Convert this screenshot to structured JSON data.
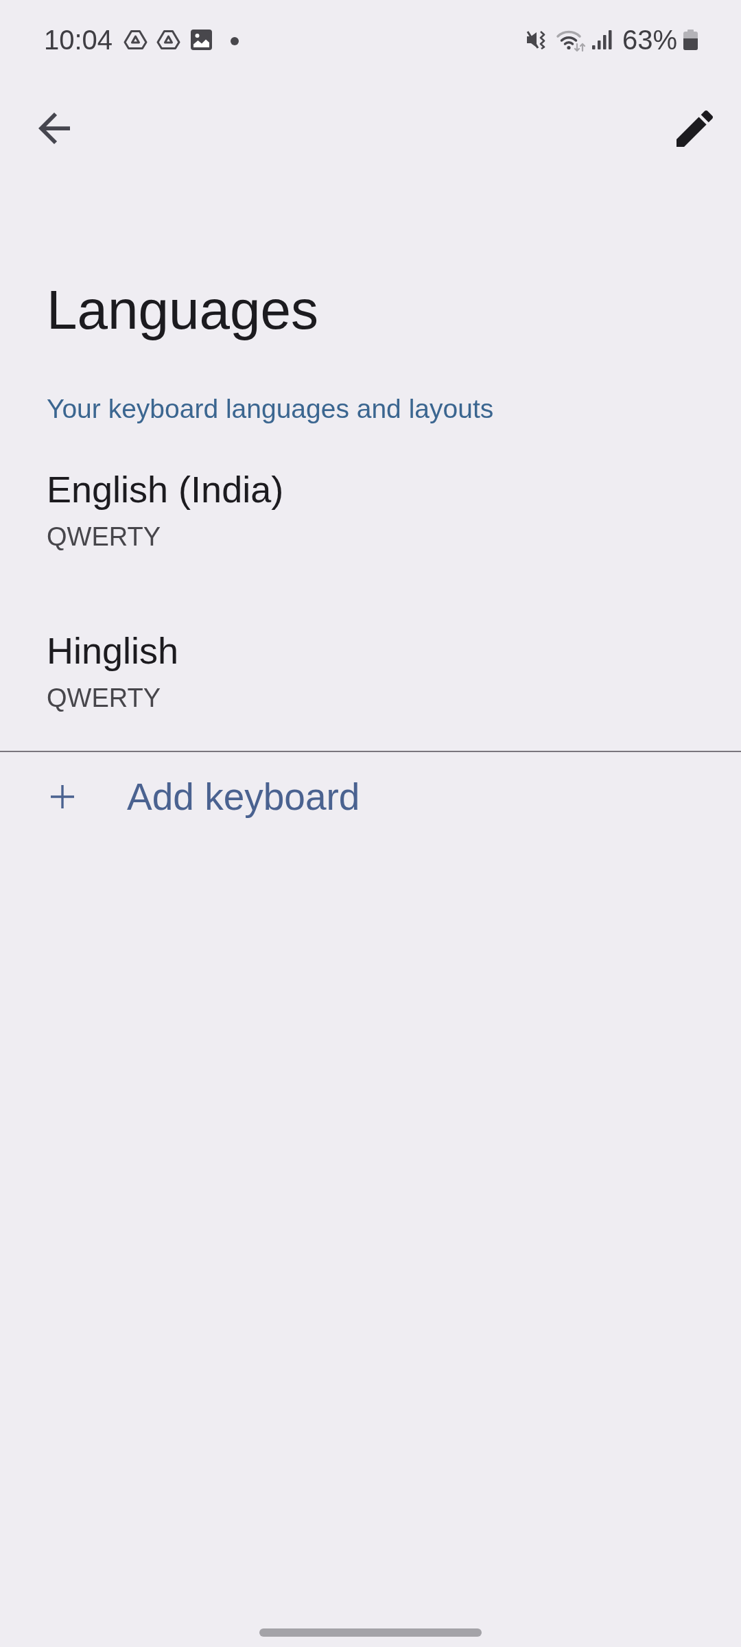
{
  "status_bar": {
    "time": "10:04",
    "battery_percent": "63%"
  },
  "title": "Languages",
  "section_header": "Your keyboard languages and layouts",
  "keyboards": [
    {
      "name": "English (India)",
      "layout": "QWERTY"
    },
    {
      "name": "Hinglish",
      "layout": "QWERTY"
    }
  ],
  "add_keyboard": {
    "label": "Add keyboard"
  }
}
